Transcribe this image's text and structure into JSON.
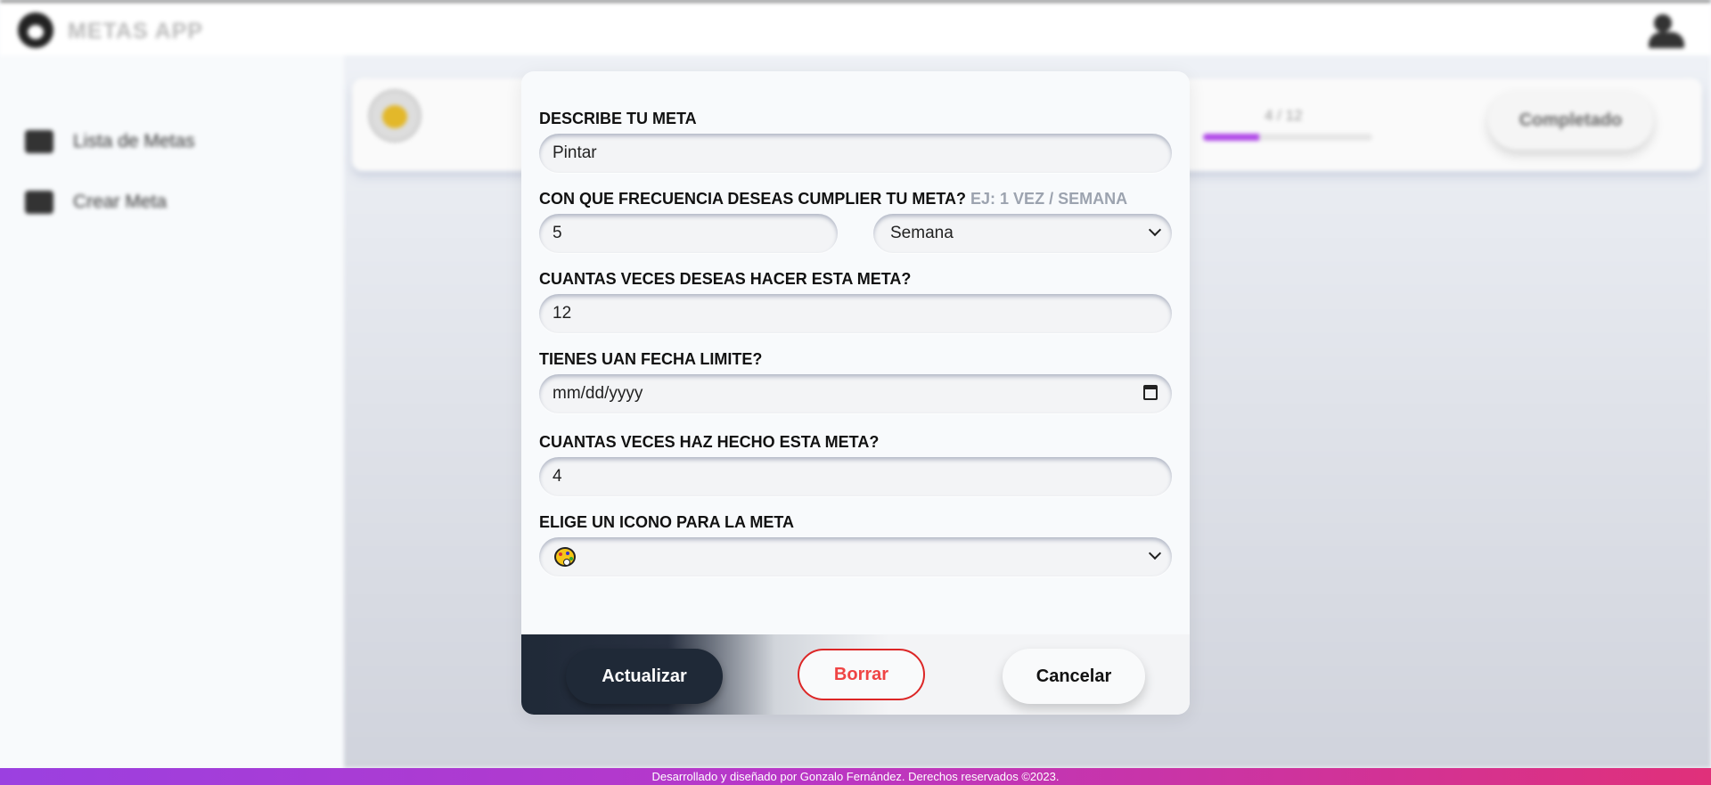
{
  "app": {
    "title": "METAS APP"
  },
  "sidebar": {
    "items": [
      {
        "label": "Lista de Metas",
        "icon": "list-icon"
      },
      {
        "label": "Crear Meta",
        "icon": "add-icon"
      }
    ]
  },
  "background_goal": {
    "icon": "palette-icon",
    "progress_text": "4 / 12",
    "progress_fraction": 0.33,
    "complete_label": "Completado"
  },
  "form": {
    "describe_label": "DESCRIBE TU META",
    "describe_value": "Pintar",
    "frequency_label": "CON QUE FRECUENCIA DESEAS CUMPLIER TU META?",
    "frequency_hint": "EJ: 1 VEZ / SEMANA",
    "frequency_value": "5",
    "period_value": "Semana",
    "total_label": "CUANTAS VECES DESEAS HACER ESTA META?",
    "total_value": "12",
    "deadline_label": "TIENES UAN FECHA LIMITE?",
    "deadline_placeholder": "mm/dd/yyyy",
    "done_label": "CUANTAS VECES HAZ HECHO ESTA META?",
    "done_value": "4",
    "icon_label": "ELIGE UN ICONO PARA LA META",
    "icon_value": "palette-icon"
  },
  "buttons": {
    "update": "Actualizar",
    "delete": "Borrar",
    "cancel": "Cancelar"
  },
  "footer": {
    "text": "Desarrollado y diseñado por Gonzalo Fernández. Derechos reservados ©2023."
  },
  "colors": {
    "primary_dark": "#1f2937",
    "danger": "#dc2626",
    "footer_gradient_start": "#9b40e0",
    "footer_gradient_end": "#e0307a"
  }
}
